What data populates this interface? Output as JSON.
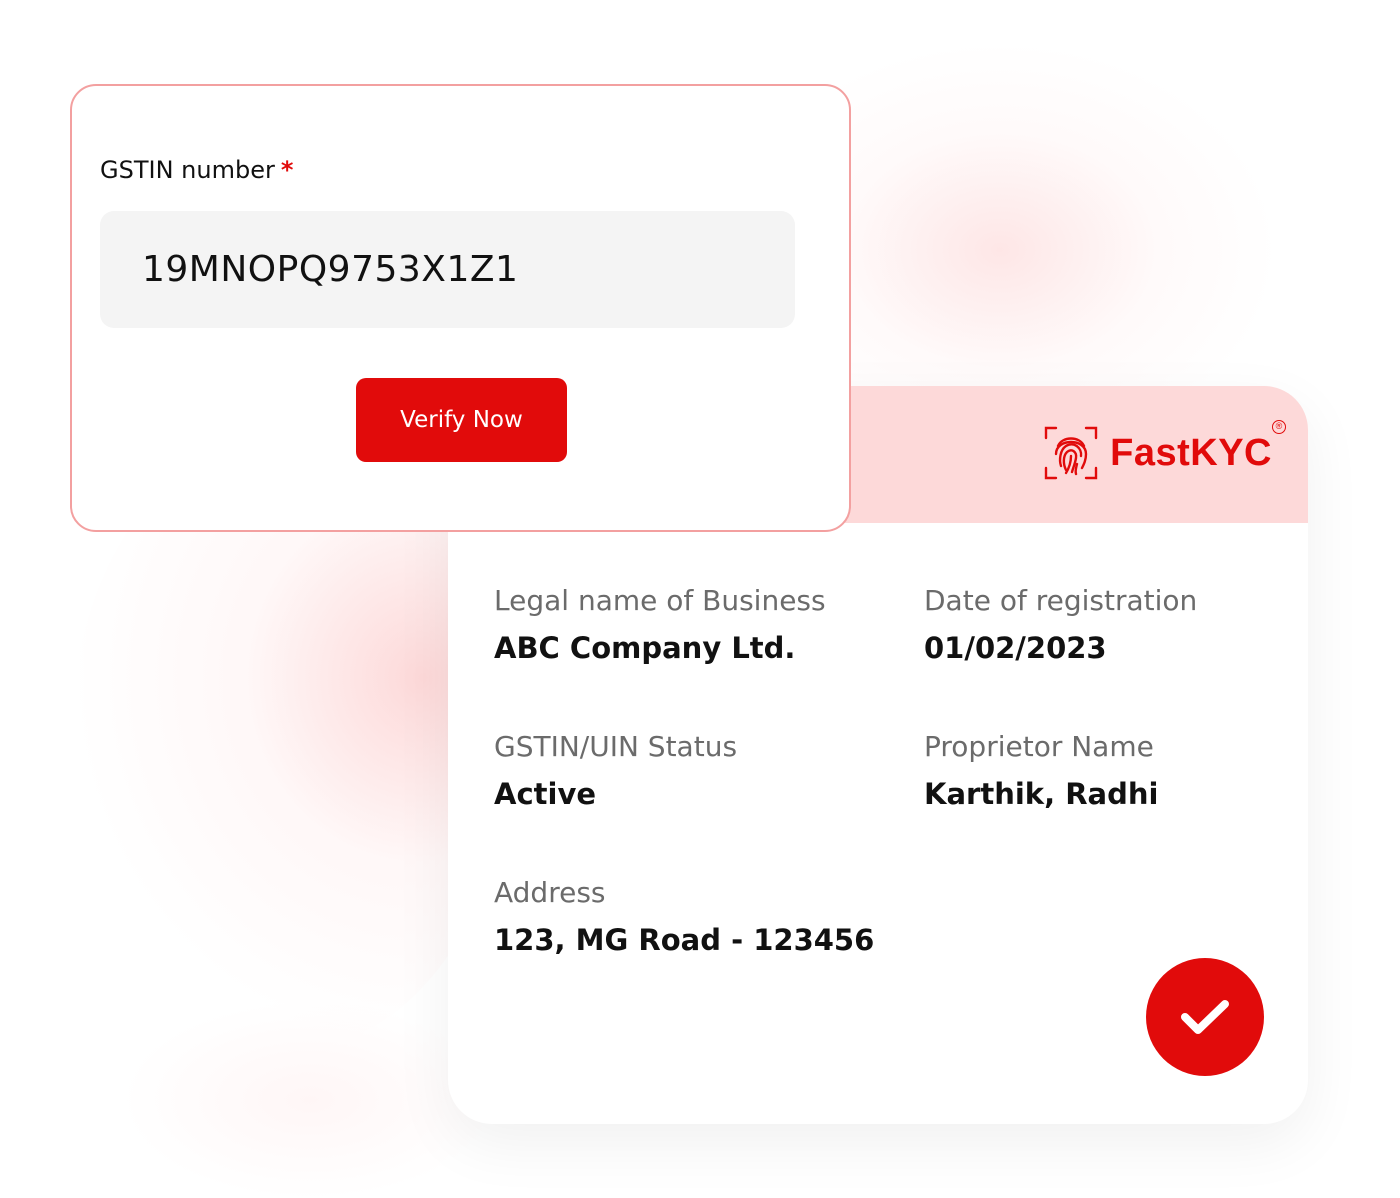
{
  "form": {
    "label": "GSTIN number",
    "required_mark": "*",
    "input_value": "19MNOPQ9753X1Z1",
    "button_label": "Verify Now"
  },
  "brand": {
    "name": "FastKYC",
    "registered_mark": "®",
    "icon": "fingerprint-scan-icon"
  },
  "result": {
    "fields": [
      {
        "label": "Legal name of Business",
        "value": "ABC Company Ltd."
      },
      {
        "label": "Date of registration",
        "value": "01/02/2023"
      },
      {
        "label": "GSTIN/UIN Status",
        "value": "Active"
      },
      {
        "label": "Proprietor Name",
        "value": "Karthik, Radhi"
      },
      {
        "label": "Address",
        "value": "123, MG Road - 123456"
      }
    ],
    "status_icon": "check-circle-icon"
  },
  "colors": {
    "accent": "#e10b0b",
    "header_bg": "#fdd9d9",
    "input_bg": "#f4f4f4",
    "card_border": "#f3a0a0"
  }
}
